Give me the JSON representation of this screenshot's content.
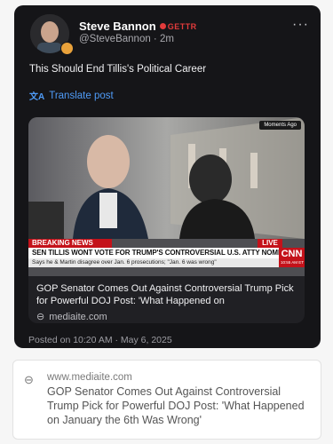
{
  "post": {
    "author_name": "Steve Bannon",
    "platform_badge": "GETTR",
    "handle": "@SteveBannon",
    "time_ago": "2m",
    "text": "This Should End Tillis's Political Career",
    "translate_label": "Translate post",
    "more_icon": "more-horizontal-icon",
    "posted_line": "Posted on 10:20 AM · May 6, 2025"
  },
  "link_card": {
    "thumbnail": {
      "moments_badge": "Moments Ago",
      "breaking_label": "BREAKING NEWS",
      "live_label": "LIVE",
      "headline": "SEN TILLIS WONT VOTE FOR TRUMP'S CONTROVERSIAL U.S. ATTY NOMINEE",
      "subline": "Says he & Martin disagree over Jan. 6 prosecutions; \"Jan. 6 was wrong\"",
      "network_logo": "CNN",
      "timestamp": "10:55 AM ET"
    },
    "title": "GOP Senator Comes Out Against Controversial Trump Pick for Powerful DOJ Post: 'What Happened on",
    "domain": "mediaite.com"
  },
  "preview": {
    "domain": "www.mediaite.com",
    "title": "GOP Senator Comes Out Against Controversial Trump Pick for Powerful DOJ Post: 'What Happened on January the 6th Was Wrong'"
  }
}
